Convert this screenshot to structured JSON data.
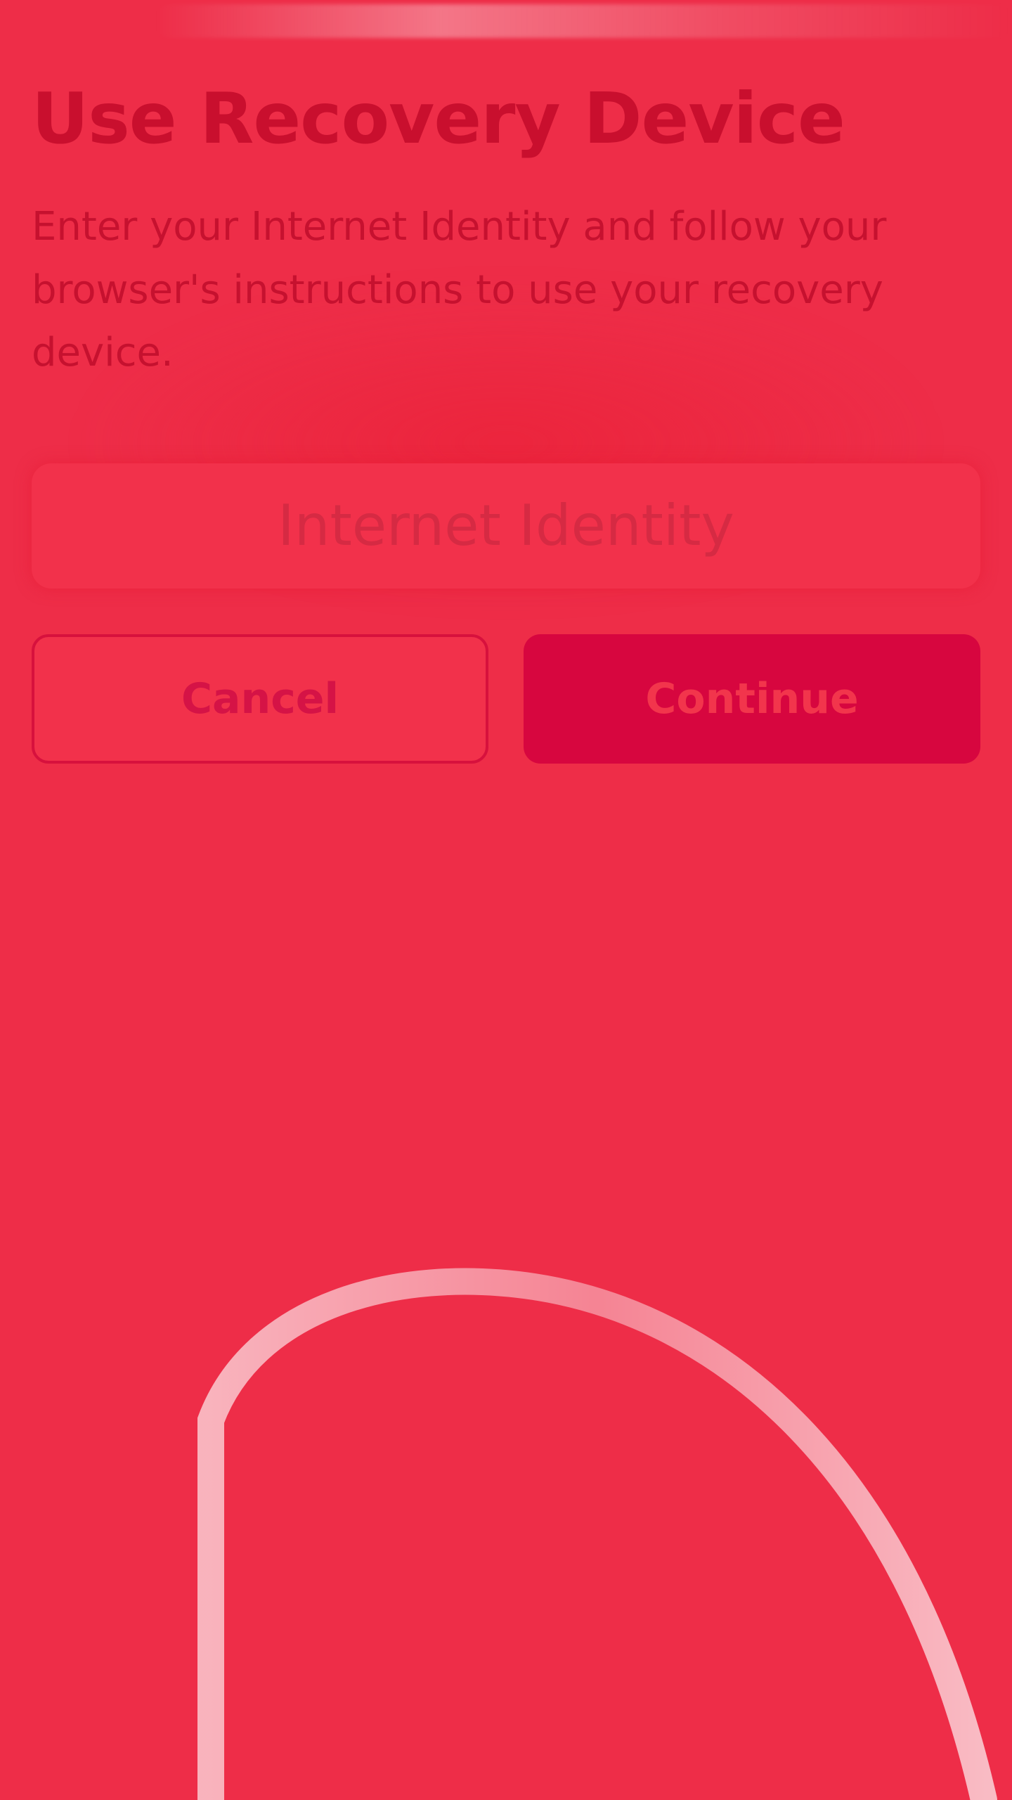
{
  "page": {
    "title": "Use Recovery Device",
    "description": "Enter your Internet Identity and follow your browser's instructions to use your recovery device."
  },
  "form": {
    "identity_placeholder": "Internet Identity",
    "identity_value": ""
  },
  "actions": {
    "cancel_label": "Cancel",
    "continue_label": "Continue"
  },
  "colors": {
    "background": "#ee2d48",
    "title_text": "#c90f2e",
    "primary_button": "#d7063f",
    "secondary_border": "#d7113d"
  }
}
